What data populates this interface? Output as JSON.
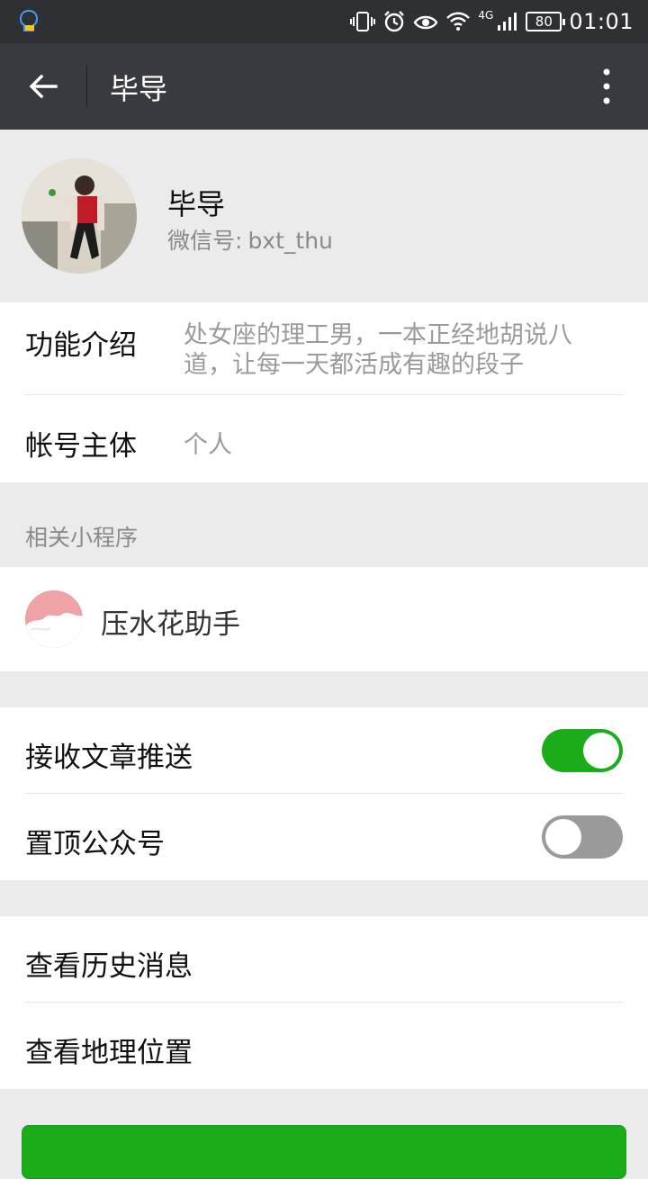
{
  "status_bar": {
    "battery": "80",
    "network": "4G",
    "time": "01:01"
  },
  "app_bar": {
    "title": "毕导"
  },
  "profile": {
    "name": "毕导",
    "wechat_label": "微信号:",
    "wechat_id": "bxt_thu"
  },
  "info": {
    "intro_label": "功能介绍",
    "intro_value": "处女座的理工男，一本正经地胡说八道，让每一天都活成有趣的段子",
    "account_label": "帐号主体",
    "account_value": "个人"
  },
  "mini_programs": {
    "header": "相关小程序",
    "items": [
      {
        "label": "压水花助手"
      }
    ]
  },
  "settings": {
    "receive_push": {
      "label": "接收文章推送",
      "on": true
    },
    "pin_top": {
      "label": "置顶公众号",
      "on": false
    }
  },
  "links": {
    "history": "查看历史消息",
    "location": "查看地理位置"
  },
  "colors": {
    "accent_green": "#1aad19",
    "app_bar": "#393a3f",
    "status_bar": "#2f3033"
  }
}
